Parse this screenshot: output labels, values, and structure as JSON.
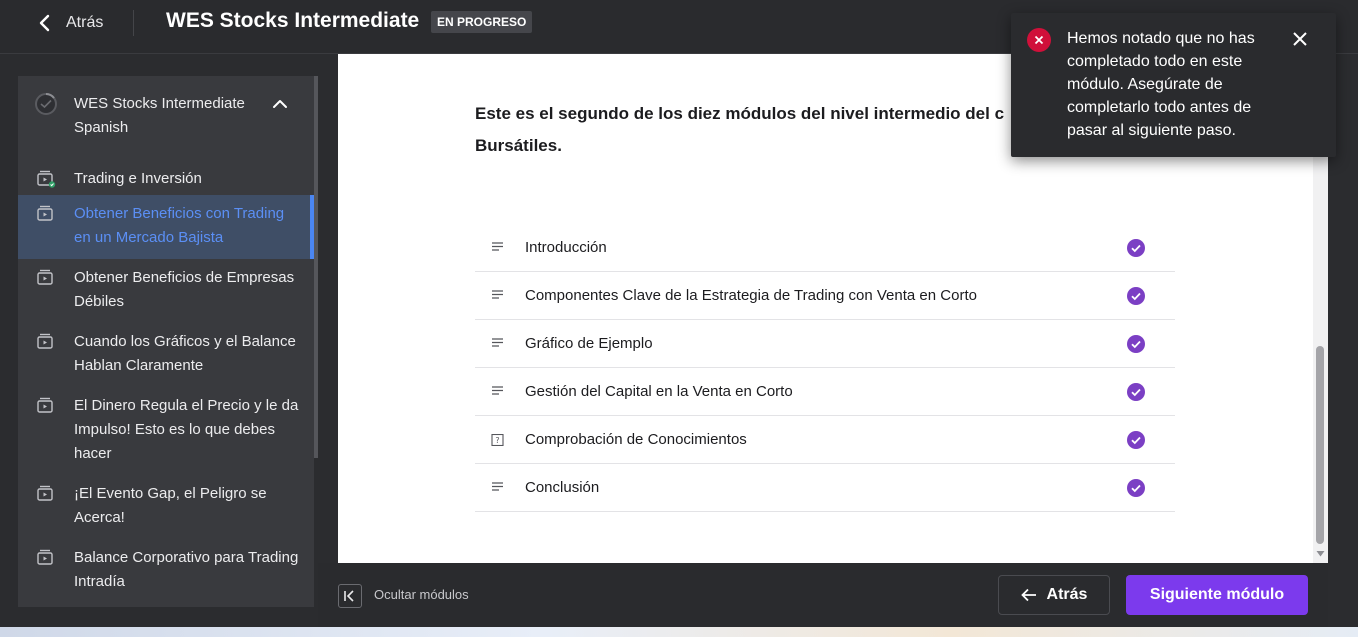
{
  "topbar": {
    "back_label": "Atrás",
    "course_title": "WES Stocks Intermediate",
    "status": "EN PROGRESO"
  },
  "sidebar": {
    "module_title": "WES Stocks Intermediate Spanish",
    "lessons": [
      {
        "label": "Trading e Inversión",
        "completed": true,
        "active": false
      },
      {
        "label": "Obtener Beneficios con Trading en un Mercado Bajista",
        "completed": false,
        "active": true
      },
      {
        "label": "Obtener Beneficios de Empresas Débiles",
        "completed": false,
        "active": false
      },
      {
        "label": "Cuando los Gráficos y el Balance Hablan Claramente",
        "completed": false,
        "active": false
      },
      {
        "label": "El Dinero Regula el Precio y le da Impulso! Esto es lo que debes hacer",
        "completed": false,
        "active": false
      },
      {
        "label": "¡El Evento Gap, el Peligro se Acerca!",
        "completed": false,
        "active": false
      },
      {
        "label": "Balance Corporativo para Trading Intradía",
        "completed": false,
        "active": false
      }
    ]
  },
  "main": {
    "intro": "Este es el segundo de los diez módulos del nivel intermedio del c",
    "intro_line2": "Bursátiles.",
    "outline": [
      {
        "label": "Introducción",
        "icon": "text-lines-icon"
      },
      {
        "label": "Componentes Clave de la Estrategia de Trading con Venta en Corto",
        "icon": "text-lines-icon"
      },
      {
        "label": "Gráfico de Ejemplo",
        "icon": "text-lines-icon"
      },
      {
        "label": "Gestión del Capital en la Venta en Corto",
        "icon": "text-lines-icon"
      },
      {
        "label": "Comprobación de Conocimientos",
        "icon": "quiz-icon"
      },
      {
        "label": "Conclusión",
        "icon": "text-lines-icon"
      }
    ]
  },
  "footer": {
    "hide_modules_label": "Ocultar módulos",
    "back_label": "Atrás",
    "next_label": "Siguiente módulo"
  },
  "toast": {
    "message": "Hemos notado que no has completado todo en este módulo. Asegúrate de completarlo todo antes de pasar al siguiente paso."
  },
  "colors": {
    "accent": "#7c3aed",
    "active_link": "#5b8ff5",
    "error": "#d0103a",
    "check": "#7b3fc4"
  }
}
